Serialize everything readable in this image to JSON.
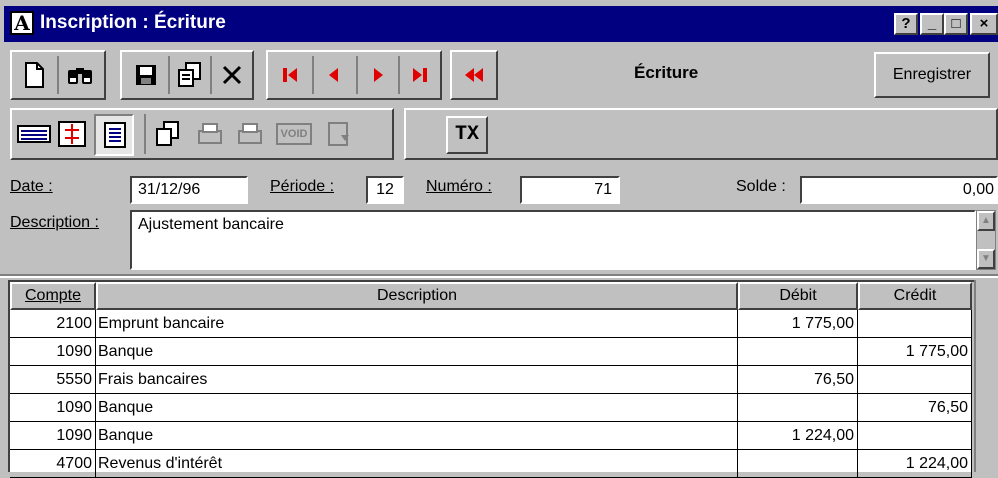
{
  "window": {
    "title": "Inscription : Écriture",
    "app_icon_letter": "A",
    "controls": [
      "?",
      "_",
      "□",
      "×"
    ]
  },
  "toolbar": {
    "record_type_label": "Écriture",
    "save_button_label": "Enregistrer",
    "tax_button_label": "TX",
    "void_label": "VOID"
  },
  "form": {
    "date_label": "Date :",
    "date_value": "31/12/96",
    "period_label": "Période :",
    "period_value": "12",
    "number_label": "Numéro :",
    "number_value": "71",
    "balance_label": "Solde :",
    "balance_value": "0,00",
    "description_label": "Description :",
    "description_value": "Ajustement bancaire"
  },
  "table": {
    "columns": [
      "Compte",
      "Description",
      "Débit",
      "Crédit"
    ],
    "rows": [
      {
        "compte": "2100",
        "description": "Emprunt bancaire",
        "debit": "1 775,00",
        "credit": ""
      },
      {
        "compte": "1090",
        "description": "Banque",
        "debit": "",
        "credit": "1 775,00"
      },
      {
        "compte": "5550",
        "description": "Frais bancaires",
        "debit": "76,50",
        "credit": ""
      },
      {
        "compte": "1090",
        "description": "Banque",
        "debit": "",
        "credit": "76,50"
      },
      {
        "compte": "1090",
        "description": "Banque",
        "debit": "1 224,00",
        "credit": ""
      },
      {
        "compte": "4700",
        "description": "Revenus d'intérêt",
        "debit": "",
        "credit": "1 224,00"
      }
    ]
  },
  "colors": {
    "title_bar": "#000080",
    "nav_arrows": "#e00000",
    "face": "#c0c0c0"
  }
}
